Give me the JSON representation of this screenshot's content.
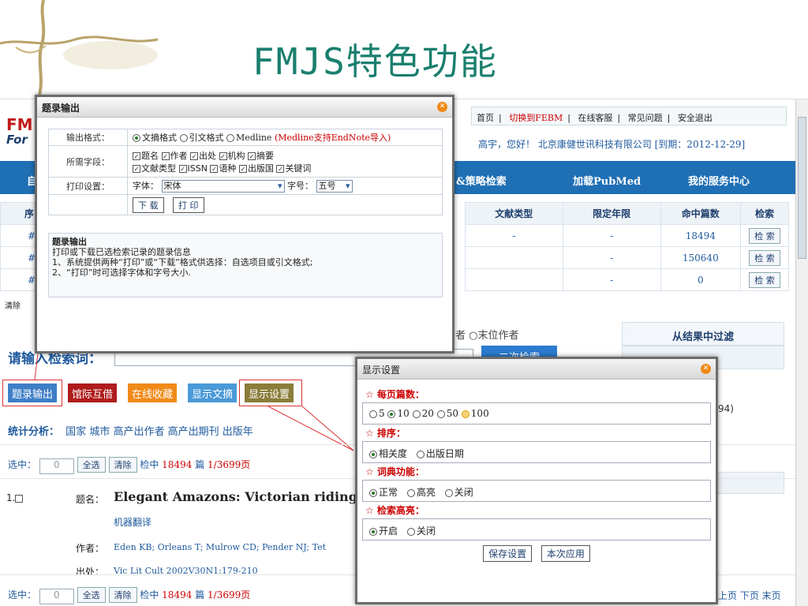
{
  "slide_title": "FMJS特色功能",
  "site": {
    "logo_line1": "FM",
    "logo_line2": "For",
    "top_links": [
      "首页",
      "切换到FEBM",
      "在线客服",
      "常见问题",
      "安全退出"
    ],
    "user_text": "高宇，您好！ 北京康健世讯科技有限公司 [到期：2012-12-29]",
    "nav": [
      "自",
      "&策略检索",
      "加载PubMed",
      "我的服务中心"
    ],
    "history_headers": [
      "序",
      "文献类型",
      "限定年限",
      "命中篇数",
      "检索"
    ],
    "history_rows": [
      {
        "id": "#",
        "type": "-",
        "year": "-",
        "hits": "18494",
        "action": "检 索"
      },
      {
        "id": "#",
        "type": "",
        "year": "-",
        "hits": "150640",
        "action": "检 索"
      },
      {
        "id": "#",
        "type": "",
        "year": "-",
        "hits": "0",
        "action": "检 索"
      }
    ],
    "clear_label": "清除",
    "author_option": "者 ○末位作者",
    "filter_title": "从结果中过滤",
    "search_prompt": "请输入检索词：",
    "secondary_search": "二次检索",
    "partial_count": "94)",
    "toolbar": [
      "题录输出",
      "馆际互借",
      "在线收藏",
      "显示文摘",
      "显示设置"
    ],
    "stats_label": "统计分析：",
    "stats_links": [
      "国家",
      "城市",
      "高产出作者",
      "高产出期刊",
      "出版年"
    ],
    "select_label": "选中：",
    "select_count": "0",
    "select_all": "全选",
    "clear_btn": "清除",
    "found_prefix": "检中",
    "found_count": "18494",
    "found_unit": "篇",
    "page_info": "1/3699页",
    "result": {
      "index": "1.",
      "title_label": "题名：",
      "title": "Elegant Amazons: Victorian riding h",
      "translate": "机器翻译",
      "author_label": "作者：",
      "authors": "Eden KB; Orleans T; Mulrow CD; Pender NJ; Tet",
      "source_label": "出处：",
      "source": "Vic Lit Cult 2002V30N1:179-210"
    },
    "pager": "上页 下页 末页"
  },
  "export_dialog": {
    "title": "题录输出",
    "format_label": "输出格式：",
    "formats": [
      "文摘格式",
      "引文格式",
      "Medline"
    ],
    "format_note": "(Medline支持EndNote导入)",
    "fields_label": "所需字段：",
    "fields_row1": [
      "题名",
      "作者",
      "出处",
      "机构",
      "摘要"
    ],
    "fields_row2": [
      "文献类型",
      "ISSN",
      "语种",
      "出版国",
      "关键词"
    ],
    "print_label": "打印设置：",
    "font_label": "字体：",
    "font_value": "宋体",
    "size_label": "字号：",
    "size_value": "五号",
    "download_btn": "下 载",
    "print_btn": "打 印",
    "help_title": "题录输出",
    "help_lines": [
      "打印或下载已选检索记录的题录信息",
      "1、系统提供两种“打印”或“下载”格式供选择：自选项目或引文格式;",
      "2、“打印”时可选择字体和字号大小."
    ]
  },
  "display_dialog": {
    "title": "显示设置",
    "per_page_label": "☆ 每页篇数：",
    "per_page_options": [
      "5",
      "10",
      "20",
      "50",
      "100"
    ],
    "per_page_selected": "10",
    "sort_label": "☆ 排序：",
    "sort_options": [
      "相关度",
      "出版日期"
    ],
    "dict_label": "☆ 词典功能：",
    "dict_options": [
      "正常",
      "高亮",
      "关闭"
    ],
    "highlight_label": "☆ 检索高亮：",
    "highlight_options": [
      "开启",
      "关闭"
    ],
    "save_btn": "保存设置",
    "apply_btn": "本次应用"
  },
  "colors": {
    "title": "#1a7f6e",
    "nav_bar": "#1f6fb5",
    "btn_export": "#3f7fc7",
    "btn_ill": "#b01c1c",
    "btn_fav": "#f08a18",
    "btn_abs": "#4a9ad8",
    "btn_disp": "#8a7d3a"
  }
}
